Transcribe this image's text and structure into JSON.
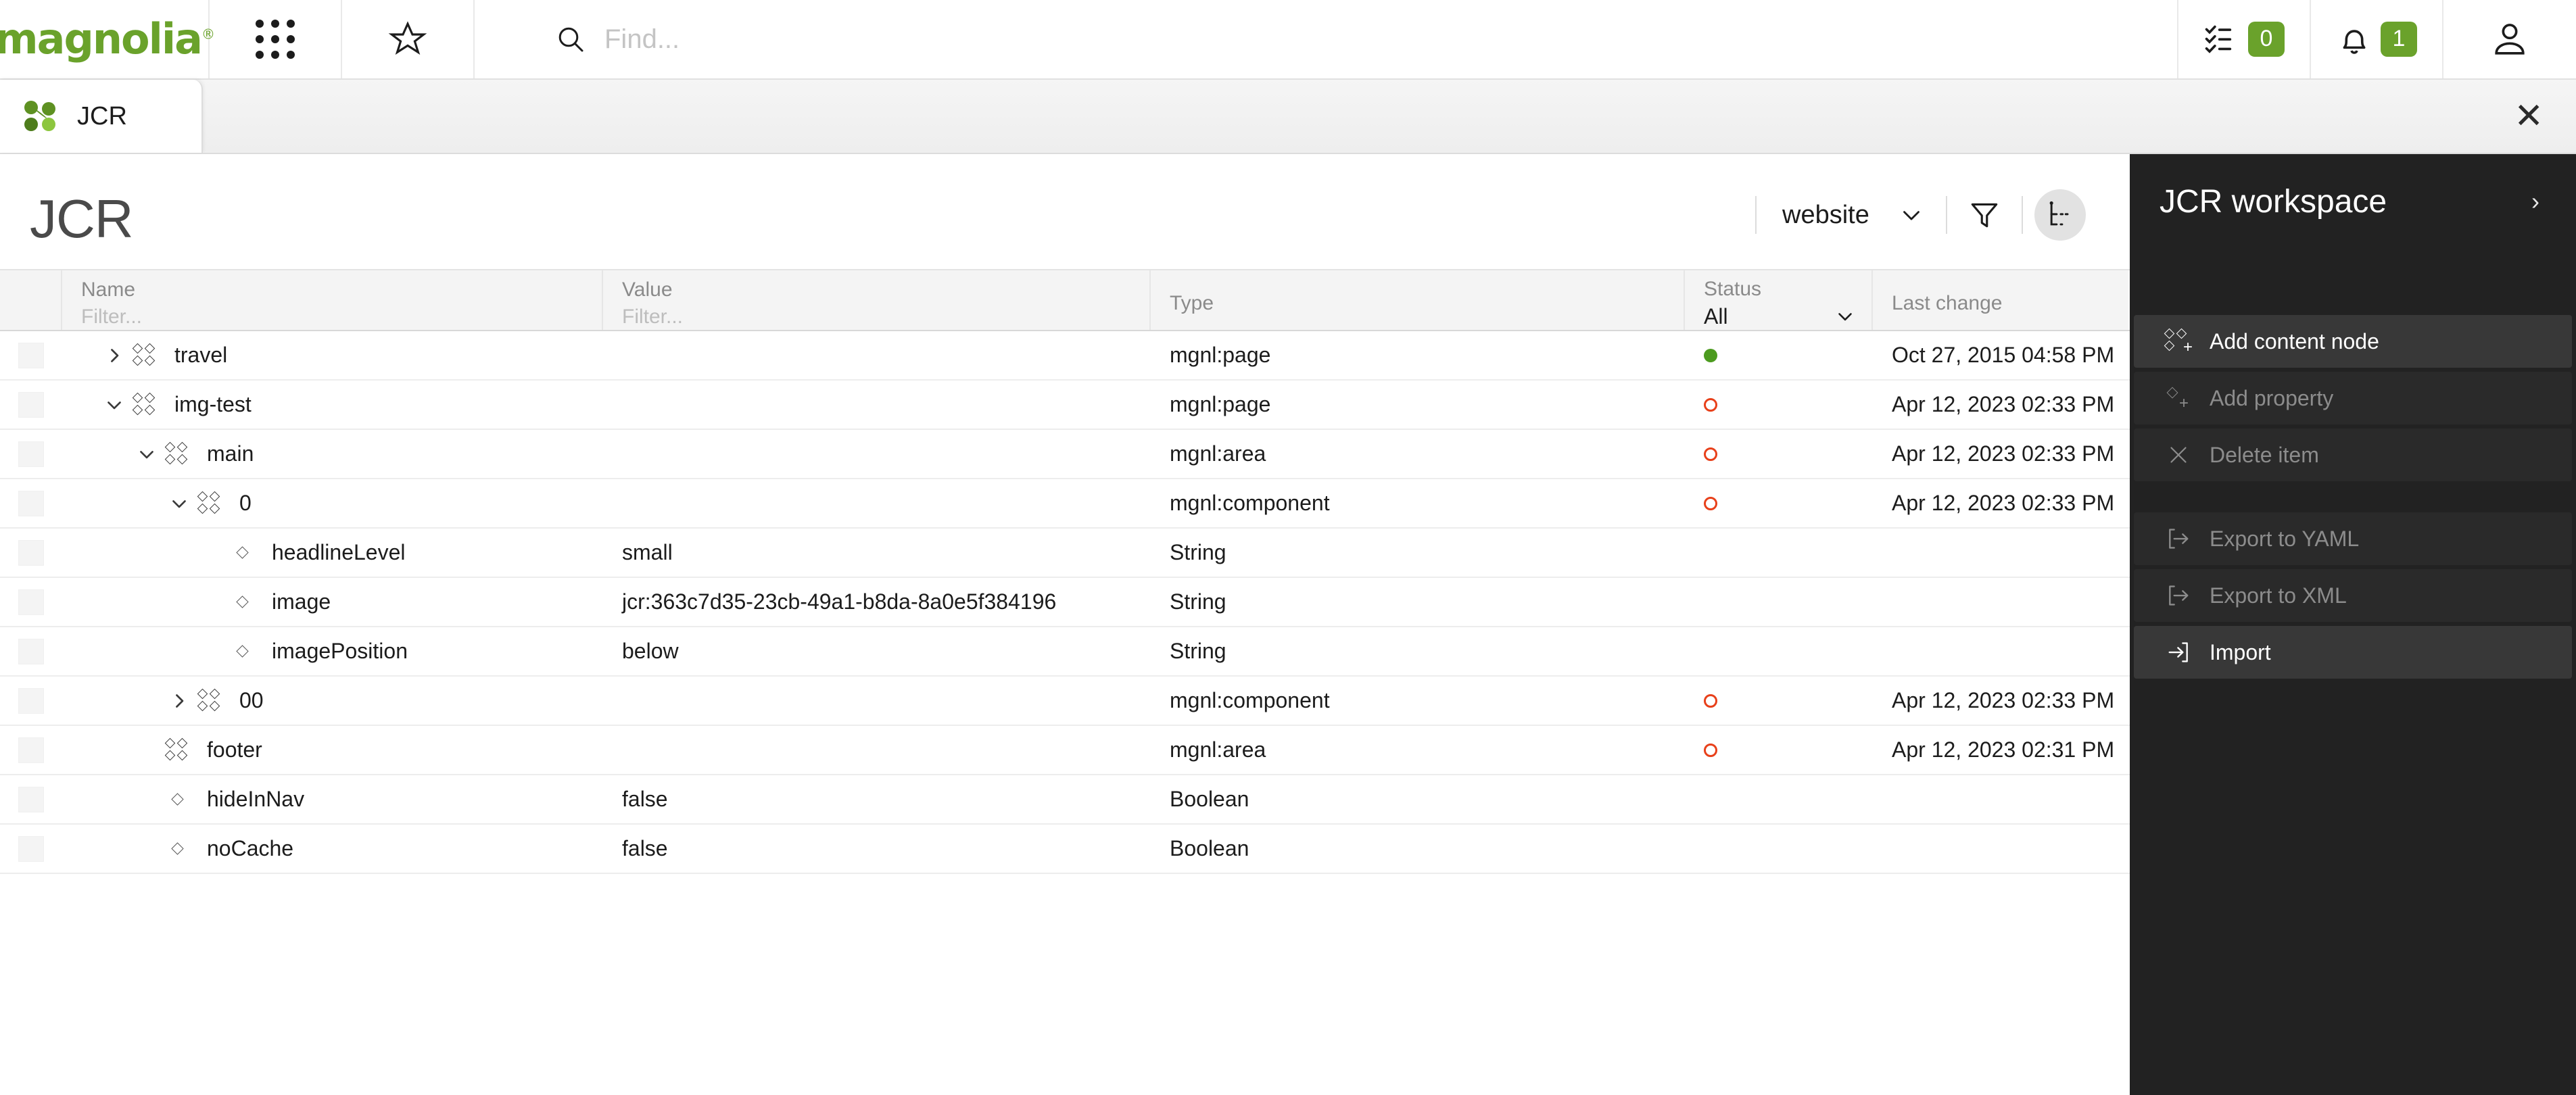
{
  "topbar": {
    "logo": "magnolia",
    "logo_registered": "®",
    "apps_icon": "apps-grid-icon",
    "favorites_icon": "star-icon",
    "search": {
      "icon": "search-icon",
      "placeholder": "Find...",
      "value": ""
    },
    "tasks": {
      "icon": "tasks-checklist-icon",
      "badge": "0"
    },
    "notifications": {
      "icon": "bell-icon",
      "badge": "1"
    },
    "user": {
      "icon": "user-avatar-icon"
    },
    "badge_color": "#6aa22b"
  },
  "tabbar": {
    "active_tab": {
      "label": "JCR",
      "icon": "jcr-node-graph-icon"
    },
    "close_icon": "close-icon"
  },
  "page": {
    "title": "JCR",
    "workspace_select": {
      "value": "website",
      "chevron": "chevron-down-icon"
    },
    "filter_icon": "funnel-filter-icon",
    "tree_view_icon": "tree-view-icon",
    "tree_view_active": true
  },
  "table": {
    "columns": [
      {
        "key": "name",
        "label": "Name",
        "filter_placeholder": "Filter..."
      },
      {
        "key": "value",
        "label": "Value",
        "filter_placeholder": "Filter..."
      },
      {
        "key": "type",
        "label": "Type",
        "filter_placeholder": ""
      },
      {
        "key": "status",
        "label": "Status",
        "select_value": "All"
      },
      {
        "key": "last",
        "label": "Last change",
        "filter_placeholder": ""
      }
    ],
    "rows": [
      {
        "depth": 0,
        "kind": "node",
        "twisty": "collapsed",
        "name": "travel",
        "value": "",
        "type": "mgnl:page",
        "status": "published",
        "last": "Oct 27, 2015 04:58 PM"
      },
      {
        "depth": 0,
        "kind": "node",
        "twisty": "expanded",
        "name": "img-test",
        "value": "",
        "type": "mgnl:page",
        "status": "modified",
        "last": "Apr 12, 2023 02:33 PM"
      },
      {
        "depth": 1,
        "kind": "node",
        "twisty": "expanded",
        "name": "main",
        "value": "",
        "type": "mgnl:area",
        "status": "modified",
        "last": "Apr 12, 2023 02:33 PM"
      },
      {
        "depth": 2,
        "kind": "node",
        "twisty": "expanded",
        "name": "0",
        "value": "",
        "type": "mgnl:component",
        "status": "modified",
        "last": "Apr 12, 2023 02:33 PM"
      },
      {
        "depth": 3,
        "kind": "prop",
        "twisty": "none",
        "name": "headlineLevel",
        "value": "small",
        "type": "String",
        "status": "",
        "last": ""
      },
      {
        "depth": 3,
        "kind": "prop",
        "twisty": "none",
        "name": "image",
        "value": "jcr:363c7d35-23cb-49a1-b8da-8a0e5f384196",
        "type": "String",
        "status": "",
        "last": ""
      },
      {
        "depth": 3,
        "kind": "prop",
        "twisty": "none",
        "name": "imagePosition",
        "value": "below",
        "type": "String",
        "status": "",
        "last": ""
      },
      {
        "depth": 2,
        "kind": "node",
        "twisty": "collapsed",
        "name": "00",
        "value": "",
        "type": "mgnl:component",
        "status": "modified",
        "last": "Apr 12, 2023 02:33 PM"
      },
      {
        "depth": 1,
        "kind": "node",
        "twisty": "none",
        "name": "footer",
        "value": "",
        "type": "mgnl:area",
        "status": "modified",
        "last": "Apr 12, 2023 02:31 PM"
      },
      {
        "depth": 1,
        "kind": "prop",
        "twisty": "none",
        "name": "hideInNav",
        "value": "false",
        "type": "Boolean",
        "status": "",
        "last": ""
      },
      {
        "depth": 1,
        "kind": "prop",
        "twisty": "none",
        "name": "noCache",
        "value": "false",
        "type": "Boolean",
        "status": "",
        "last": ""
      }
    ],
    "status_colors": {
      "published": "#4c9b1f",
      "modified": "#e8401a"
    }
  },
  "panel": {
    "title": "JCR workspace",
    "collapse_icon": "chevron-right-icon",
    "actions": [
      {
        "label": "Add content node",
        "icon": "add-content-node-icon",
        "enabled": true,
        "group": 1
      },
      {
        "label": "Add property",
        "icon": "add-property-icon",
        "enabled": false,
        "group": 1
      },
      {
        "label": "Delete item",
        "icon": "delete-x-icon",
        "enabled": false,
        "group": 1
      },
      {
        "label": "Export to YAML",
        "icon": "export-icon",
        "enabled": false,
        "group": 2
      },
      {
        "label": "Export to XML",
        "icon": "export-icon",
        "enabled": false,
        "group": 2
      },
      {
        "label": "Import",
        "icon": "import-icon",
        "enabled": true,
        "group": 2
      }
    ]
  }
}
